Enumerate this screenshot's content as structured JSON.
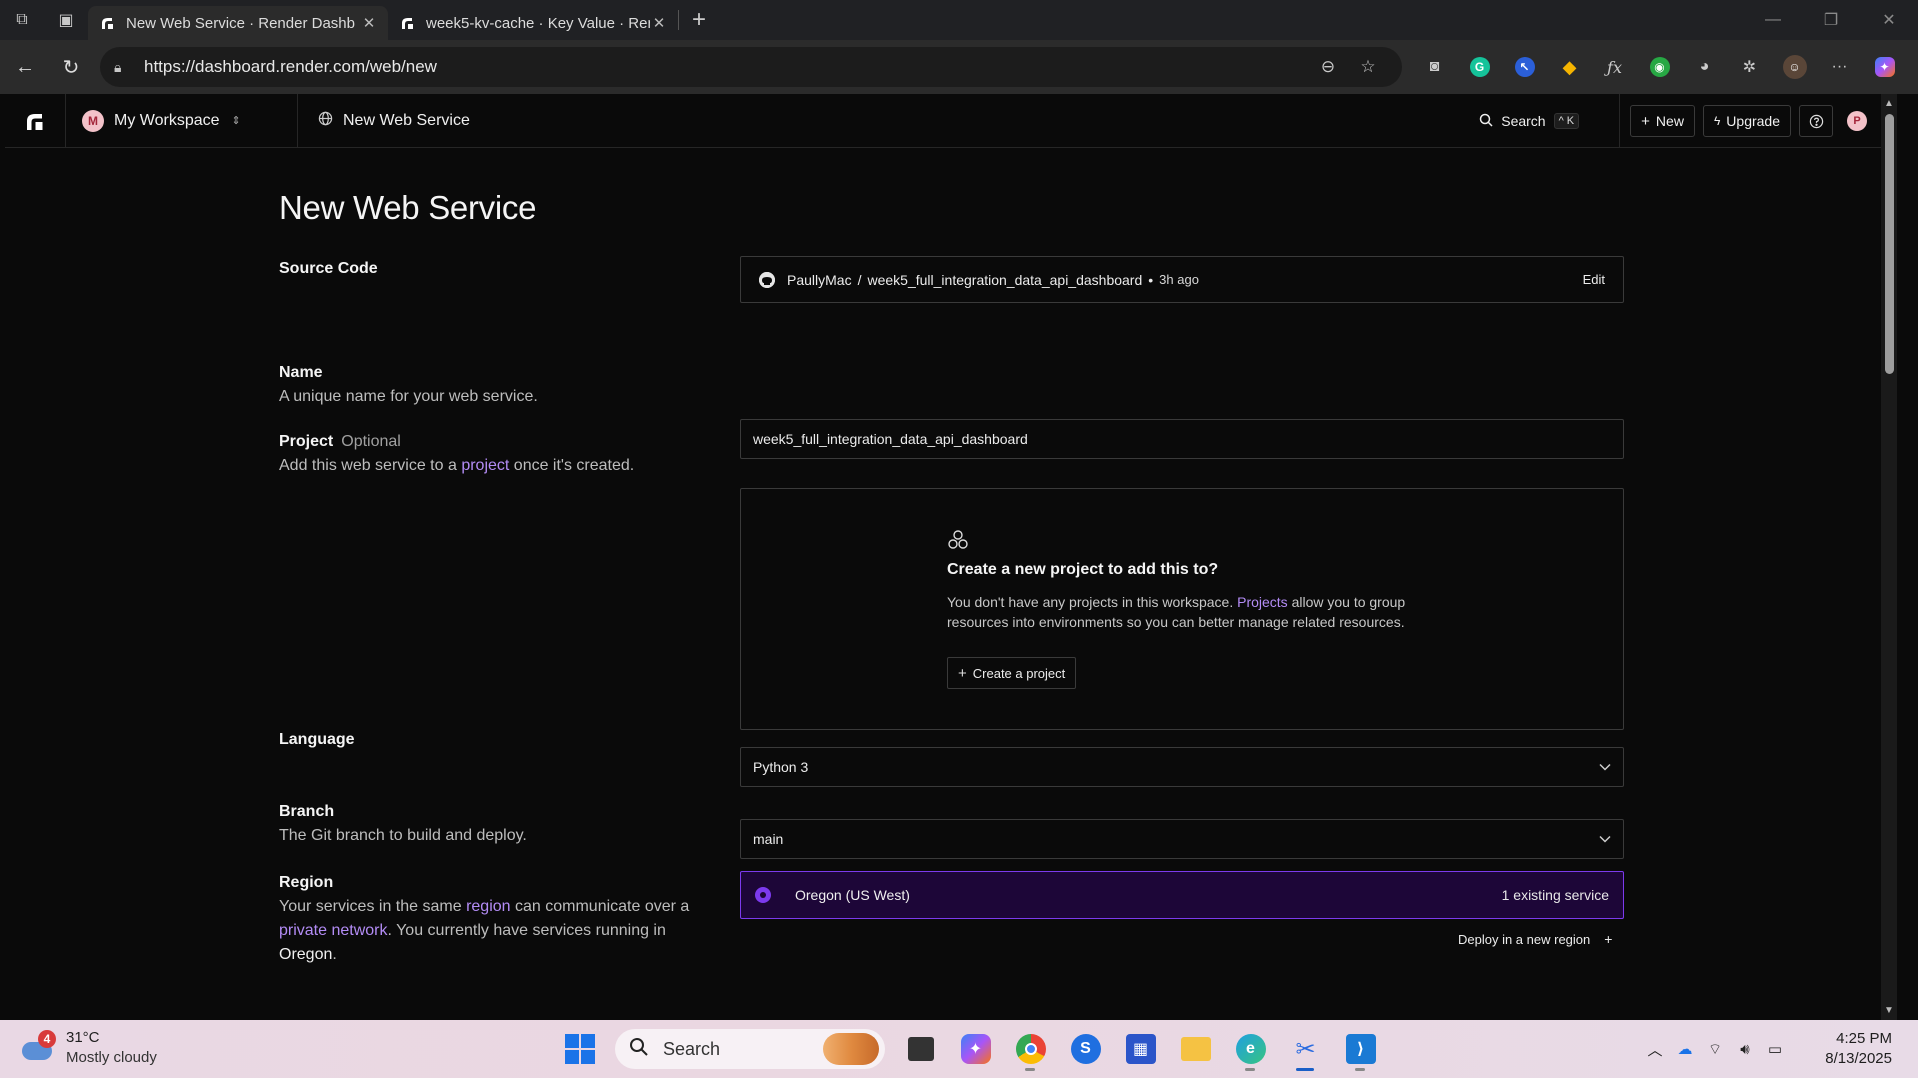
{
  "browser": {
    "tabs": [
      {
        "title": "New Web Service · Render Dashb",
        "active": true
      },
      {
        "title": "week5-kv-cache · Key Value · Ren",
        "active": false
      }
    ],
    "url": "https://dashboard.render.com/web/new"
  },
  "topnav": {
    "workspace_avatar": "M",
    "workspace_name": "My Workspace",
    "breadcrumb": "New Web Service",
    "search_label": "Search",
    "search_shortcut": "^ K",
    "new_label": "New",
    "upgrade_label": "Upgrade",
    "user_avatar": "P"
  },
  "page": {
    "title": "New Web Service",
    "source_code": {
      "label": "Source Code",
      "owner": "PaullyMac",
      "repo": "week5_full_integration_data_api_dashboard",
      "age": "3h ago",
      "edit_label": "Edit"
    },
    "name": {
      "label": "Name",
      "description": "A unique name for your web service.",
      "value": "week5_full_integration_data_api_dashboard"
    },
    "project": {
      "label": "Project",
      "optional": "Optional",
      "desc_pre": "Add this web service to a ",
      "desc_link": "project",
      "desc_post": " once it's created.",
      "box_title": "Create a new project to add this to?",
      "box_text_pre": "You don't have any projects in this workspace. ",
      "box_text_link": "Projects",
      "box_text_post": " allow you to group resources into environments so you can better manage related resources.",
      "create_label": "Create a project"
    },
    "language": {
      "label": "Language",
      "value": "Python 3"
    },
    "branch": {
      "label": "Branch",
      "description": "The Git branch to build and deploy.",
      "value": "main"
    },
    "region": {
      "label": "Region",
      "desc_pre": "Your services in the same ",
      "desc_link1": "region",
      "desc_mid": " can communicate over a ",
      "desc_link2": "private network",
      "desc_post": ". You currently have services running in ",
      "desc_bold": "Oregon",
      "desc_end": ".",
      "selected": "Oregon (US West)",
      "selected_count": "1 existing service",
      "deploy_new": "Deploy in a new region"
    }
  },
  "taskbar": {
    "weather_badge": "4",
    "temperature": "31°C",
    "condition": "Mostly cloudy",
    "search_placeholder": "Search",
    "time": "4:25 PM",
    "date": "8/13/2025"
  },
  "colors": {
    "accent": "#7c3aed",
    "link": "#b38cf5",
    "background": "#0a0a0a"
  }
}
